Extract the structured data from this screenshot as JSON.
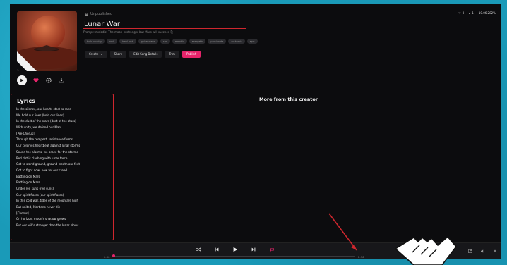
{
  "song": {
    "status": "Unpublished",
    "title": "Lunar War",
    "prompt": "Prompt: melodic, The moon is stronger but Mars will succeed",
    "tags": [
      "funk-country",
      "rock",
      "hard-rock",
      "guitar-metal",
      "syn",
      "melodic",
      "energetic",
      "passionate",
      "anthemic",
      "epic"
    ]
  },
  "actions": {
    "create": "Create",
    "share": "Share",
    "edit": "Edit Song Details",
    "trim": "Trim",
    "publish": "Publish"
  },
  "topbar": {
    "likes": "0",
    "plays": "1",
    "credits": "10.06.282%"
  },
  "lyrics": {
    "heading": "Lyrics",
    "lines": [
      "In the silence, our hearts start to race",
      "We hold our lines (hold our lines)",
      "In the dust of the stars (dust of the stars)",
      "With unity, we defend our Mars",
      "[Pre-Chorus]",
      "Through the tempest, resistance forms",
      "Our colony's heartbeat against lunar storms",
      "Sound the alarms, we brace for the storms",
      "Red dirt is clashing with lunar force",
      "Got to stand ground, ground 'neath our feet",
      "Got to fight now, now for our creed",
      "Battling on Mars",
      "Battling on Mars",
      "Under red suns (red suns)",
      "Our spirit flares (our spirit flares)",
      "In this cold war, tides of the moon are high",
      "But united, Martians never die",
      "[Chorus]",
      "On horizon, moon's shadow grows",
      "But our will's stronger than the lunar blows"
    ]
  },
  "more": {
    "heading": "More from this creator"
  },
  "player": {
    "time_elapsed": "0:00",
    "time_total": "2:36",
    "progress": 0.0
  },
  "colors": {
    "accent": "#e6246a",
    "annotation": "#d0272e",
    "desktop": "#1a9ab8"
  }
}
